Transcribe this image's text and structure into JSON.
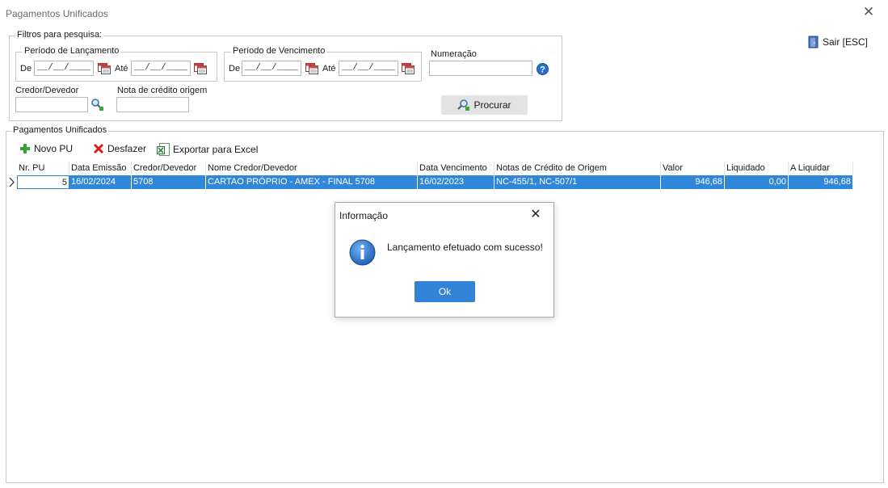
{
  "window": {
    "title": "Pagamentos Unificados"
  },
  "exit": {
    "label": "Sair [ESC]"
  },
  "filters": {
    "legend": "Filtros para pesquisa:",
    "launch_period": {
      "legend": "Período de Lançamento",
      "from_label": "De",
      "from_value": "__/__/____",
      "to_label": "Até",
      "to_value": "__/__/____"
    },
    "due_period": {
      "legend": "Período de Vencimento",
      "from_label": "De",
      "from_value": "__/__/____",
      "to_label": "Até",
      "to_value": "__/__/____"
    },
    "numbering": {
      "label": "Numeração",
      "value": ""
    },
    "creditor": {
      "label": "Credor/Devedor",
      "value": ""
    },
    "credit_note": {
      "label": "Nota de crédito origem",
      "value": ""
    },
    "search_button": {
      "label": "Procurar"
    }
  },
  "payments": {
    "legend": "Pagamentos Unificados",
    "toolbar": {
      "new_label": "Novo PU",
      "undo_label": "Desfazer",
      "export_label": "Exportar para Excel"
    },
    "columns": [
      "Nr. PU",
      "Data Emissão",
      "Credor/Devedor",
      "Nome Credor/Devedor",
      "Data Vencimento",
      "Notas de Crédito de Origem",
      "Valor",
      "Liquidado",
      "A Liquidar"
    ],
    "rows": [
      {
        "nr_pu": "5",
        "issue_date": "16/02/2024",
        "creditor": "5708",
        "creditor_name": "CARTAO PRÓPRIO - AMEX - FINAL 5708",
        "due_date": "16/02/2023",
        "credit_notes": "NC-455/1, NC-507/1",
        "value": "946,68",
        "settled": "0,00",
        "to_settle": "946,68"
      }
    ]
  },
  "dialog": {
    "title": "Informação",
    "message": "Lançamento efetuado com sucesso!",
    "ok_label": "Ok"
  },
  "colors": {
    "selection": "#3087d8",
    "ok_button": "#3182d8",
    "info_icon": "#1c5fb5"
  },
  "icons": [
    "close-icon",
    "exit-door-icon",
    "calendar-icon",
    "help-icon",
    "search-user-icon",
    "add-icon",
    "undo-x-icon",
    "excel-icon",
    "row-indicator-icon",
    "info-icon"
  ]
}
